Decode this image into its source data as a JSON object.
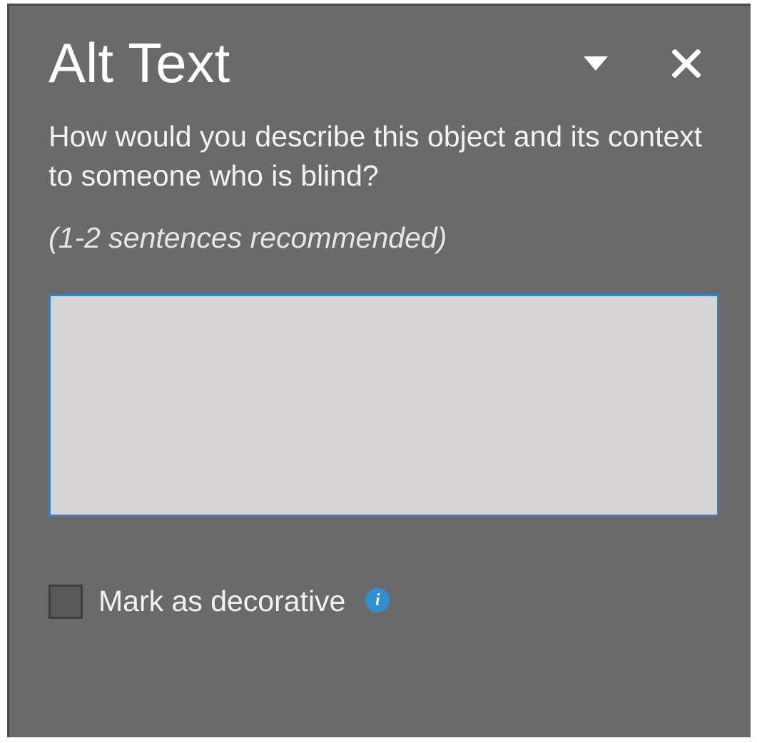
{
  "panel": {
    "title": "Alt Text",
    "description": "How would you describe this object and its context to someone who is blind?",
    "recommendation": "(1-2 sentences recommended)",
    "textarea_value": "",
    "checkbox_label": "Mark as decorative",
    "info_glyph": "i"
  }
}
